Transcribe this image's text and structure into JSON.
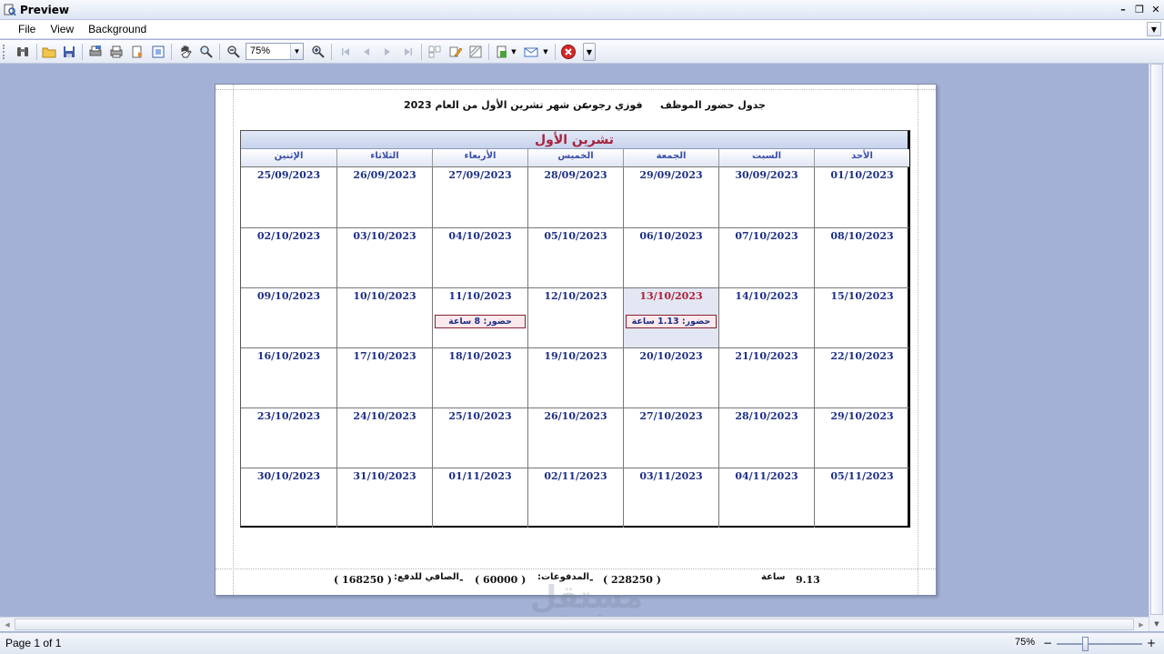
{
  "window": {
    "title": "Preview",
    "minimize": "–",
    "restore": "❐",
    "close": "✕"
  },
  "menu": [
    "File",
    "View",
    "Background"
  ],
  "toolbar": {
    "zoom_value": "75%"
  },
  "icons": {
    "app": "preview-icon",
    "find": "find-icon",
    "open": "open-folder-icon",
    "save": "save-icon",
    "print_setup": "print-setup-icon",
    "print": "print-icon",
    "export": "export-icon",
    "fit": "fit-page-icon",
    "hand": "hand-icon",
    "magnifier": "magnifier-icon",
    "zoom_out": "zoom-out-icon",
    "zoom_in": "zoom-in-icon",
    "first_page": "first-page-icon",
    "prev_page": "previous-page-icon",
    "next_page": "next-page-icon",
    "last_page": "last-page-icon",
    "multi_page": "multi-page-icon",
    "edit": "edit-icon",
    "watermark": "watermark-icon",
    "export_doc": "export-document-icon",
    "email": "email-icon",
    "close_preview": "close-preview-icon"
  },
  "colors": {
    "accent_red": "#b01e38",
    "date_blue": "#1d2f86",
    "header_blue": "#3a4ea8",
    "background": "#a4b1d6"
  },
  "report": {
    "title_prefix": "جدول حضور الموظف",
    "employee": "فوزي رجوب",
    "period": "عن شهر تشرين الأول من العام 2023",
    "month": "تشرين الأول",
    "days": [
      "الأحد",
      "السبت",
      "الجمعة",
      "الخميس",
      "الأربعاء",
      "الثلاثاء",
      "الإثنين"
    ],
    "weeks": [
      [
        "01/10/2023",
        "30/09/2023",
        "29/09/2023",
        "28/09/2023",
        "27/09/2023",
        "26/09/2023",
        "25/09/2023"
      ],
      [
        "08/10/2023",
        "07/10/2023",
        "06/10/2023",
        "05/10/2023",
        "04/10/2023",
        "03/10/2023",
        "02/10/2023"
      ],
      [
        "15/10/2023",
        "14/10/2023",
        "13/10/2023",
        "12/10/2023",
        "11/10/2023",
        "10/10/2023",
        "09/10/2023"
      ],
      [
        "22/10/2023",
        "21/10/2023",
        "20/10/2023",
        "19/10/2023",
        "18/10/2023",
        "17/10/2023",
        "16/10/2023"
      ],
      [
        "29/10/2023",
        "28/10/2023",
        "27/10/2023",
        "26/10/2023",
        "25/10/2023",
        "24/10/2023",
        "23/10/2023"
      ],
      [
        "05/11/2023",
        "04/11/2023",
        "03/11/2023",
        "02/11/2023",
        "01/11/2023",
        "31/10/2023",
        "30/10/2023"
      ]
    ],
    "attendance_13": "حضور: 1.13 ساعة",
    "attendance_11": "حضور: 8 ساعة",
    "footer": {
      "total_hours": "9.13",
      "hours_unit": "ساعة",
      "gross": "( 228250 )",
      "dash1": "-",
      "payments_label": "المدفوعات:",
      "payments": "( 60000 )",
      "dash2": "-",
      "net_label": "الصافي للدفع:",
      "net": "( 168250 )"
    }
  },
  "watermark": {
    "arabic": "مستقل",
    "latin": "mostaql.com"
  },
  "status": {
    "page": "Page 1 of 1",
    "zoom": "75%",
    "zoom_minus": "−",
    "zoom_plus": "+"
  }
}
